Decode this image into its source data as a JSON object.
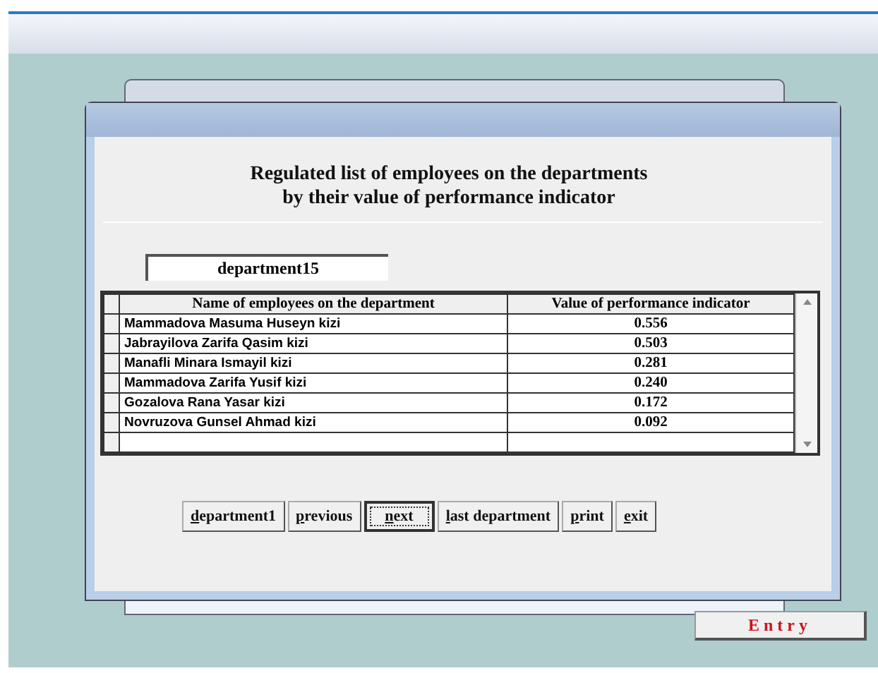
{
  "title": [
    "Regulated list of employees on the departments",
    "by their value of performance indicator"
  ],
  "department": "department15",
  "table": {
    "columns": [
      "Name of employees on the department",
      "Value of performance indicator"
    ],
    "rows": [
      [
        "Mammadova Masuma Huseyn kizi",
        "0.556"
      ],
      [
        "Jabrayilova Zarifa Qasim kizi",
        "0.503"
      ],
      [
        "Manafli Minara Ismayil kizi",
        "0.281"
      ],
      [
        "Mammadova Zarifa Yusif kizi",
        "0.240"
      ],
      [
        "Gozalova Rana Yasar kizi",
        "0.172"
      ],
      [
        "Novruzova Gunsel Ahmad kizi",
        "0.092"
      ]
    ]
  },
  "buttons": [
    {
      "label": "department1",
      "selected": false
    },
    {
      "label": "previous",
      "selected": false
    },
    {
      "label": "next",
      "selected": true
    },
    {
      "label": "last department",
      "selected": false
    },
    {
      "label": "print",
      "selected": false
    },
    {
      "label": "exit",
      "selected": false
    }
  ],
  "entry_button": "Entry"
}
